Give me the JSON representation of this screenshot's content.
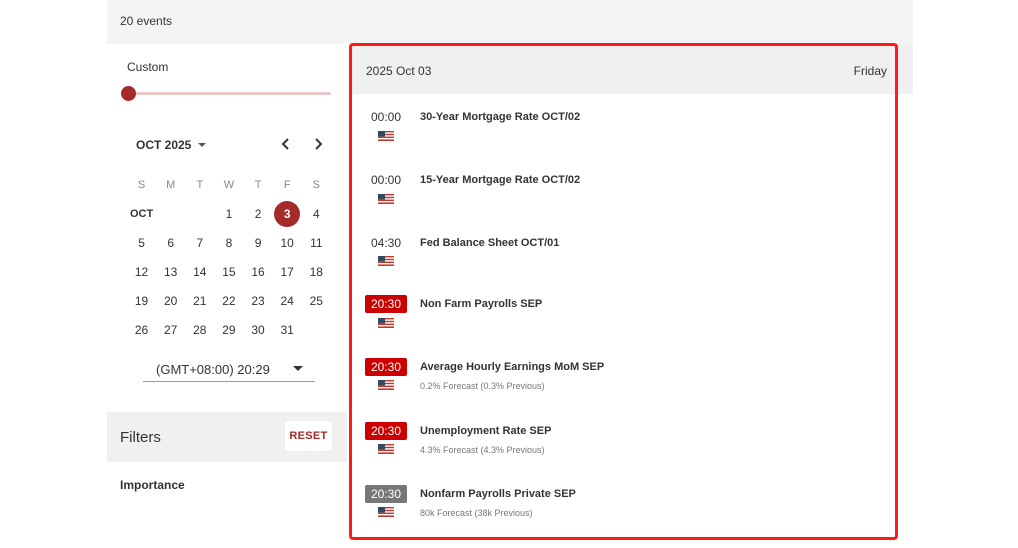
{
  "header": {
    "event_count": "20 events"
  },
  "sidebar": {
    "custom_label": "Custom",
    "calendar": {
      "month_label": "OCT 2025",
      "weekdays": [
        "S",
        "M",
        "T",
        "W",
        "T",
        "F",
        "S"
      ],
      "month_short": "OCT",
      "selected_day": "3",
      "days": [
        "1",
        "2",
        "3",
        "4",
        "5",
        "6",
        "7",
        "8",
        "9",
        "10",
        "11",
        "12",
        "13",
        "14",
        "15",
        "16",
        "17",
        "18",
        "19",
        "20",
        "21",
        "22",
        "23",
        "24",
        "25",
        "26",
        "27",
        "28",
        "29",
        "30",
        "31"
      ]
    },
    "timezone": "(GMT+08:00) 20:29",
    "filters_title": "Filters",
    "reset_label": "RESET",
    "importance_label": "Importance"
  },
  "main": {
    "date": "2025 Oct 03",
    "weekday": "Friday",
    "events": [
      {
        "time": "00:00",
        "style": "plain",
        "title": "30-Year Mortgage Rate OCT/02",
        "sub": ""
      },
      {
        "time": "00:00",
        "style": "plain",
        "title": "15-Year Mortgage Rate OCT/02",
        "sub": ""
      },
      {
        "time": "04:30",
        "style": "plain",
        "title": "Fed Balance Sheet OCT/01",
        "sub": ""
      },
      {
        "time": "20:30",
        "style": "red",
        "title": "Non Farm Payrolls SEP",
        "sub": ""
      },
      {
        "time": "20:30",
        "style": "red",
        "title": "Average Hourly Earnings MoM SEP",
        "sub": "0.2% Forecast (0.3% Previous)"
      },
      {
        "time": "20:30",
        "style": "red",
        "title": "Unemployment Rate SEP",
        "sub": "4.3% Forecast (4.3% Previous)"
      },
      {
        "time": "20:30",
        "style": "grey",
        "title": "Nonfarm Payrolls Private SEP",
        "sub": "80k Forecast (38k Previous)"
      }
    ]
  },
  "colors": {
    "accent": "#a52a2a",
    "highlight_border": "#ff1a1a",
    "time_red": "#cc0000",
    "time_grey": "#777777"
  },
  "icons": {
    "flag": "us-flag-icon"
  }
}
